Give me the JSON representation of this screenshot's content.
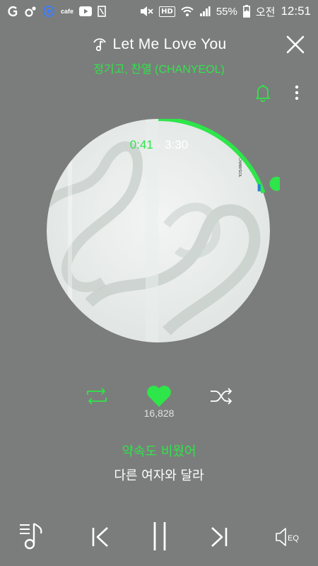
{
  "status_bar": {
    "app_icons": [
      "daum-icon",
      "cloud-icon",
      "cafe-icon",
      "youtube-icon",
      "clipboard-icon"
    ],
    "cafe_label": "cafe",
    "hd_label": "HD",
    "battery_percent": "55%",
    "am_pm": "오전",
    "clock": "12:51"
  },
  "header": {
    "title": "Let Me Love You",
    "artist": "정기고, 찬열 (CHANYEOL)"
  },
  "player": {
    "current_time": "0:41",
    "separator": "·",
    "total_time": "3:30",
    "progress_fraction": 0.195,
    "album_text": "CHANYEOL",
    "like_count": "16,828"
  },
  "lyrics": {
    "current": "약속도 비웠어",
    "next": "다른 여자와 달라"
  },
  "controls": {
    "eq_label": "EQ"
  },
  "colors": {
    "accent": "#2ee54a",
    "background": "#7b7d7c"
  }
}
